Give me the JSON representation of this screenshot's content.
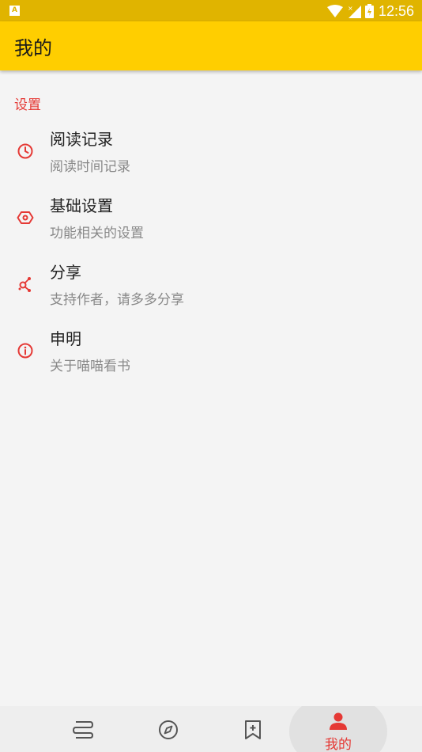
{
  "status_bar": {
    "time": "12:56",
    "notification_letter": "A"
  },
  "app_bar": {
    "title": "我的"
  },
  "section": {
    "title": "设置"
  },
  "items": [
    {
      "icon": "clock-icon",
      "title": "阅读记录",
      "subtitle": "阅读时间记录"
    },
    {
      "icon": "hexagon-settings-icon",
      "title": "基础设置",
      "subtitle": "功能相关的设置"
    },
    {
      "icon": "share-icon",
      "title": "分享",
      "subtitle": "支持作者，请多多分享"
    },
    {
      "icon": "info-icon",
      "title": "申明",
      "subtitle": "关于喵喵看书"
    }
  ],
  "bottom_nav": {
    "items": [
      {
        "icon": "bookshelf-icon",
        "label": ""
      },
      {
        "icon": "compass-icon",
        "label": ""
      },
      {
        "icon": "bookmark-add-icon",
        "label": ""
      },
      {
        "icon": "person-icon",
        "label": "我的",
        "active": true
      }
    ]
  },
  "colors": {
    "accent": "#e53935",
    "app_bar": "#ffce00",
    "status_bar": "#e0b400"
  }
}
